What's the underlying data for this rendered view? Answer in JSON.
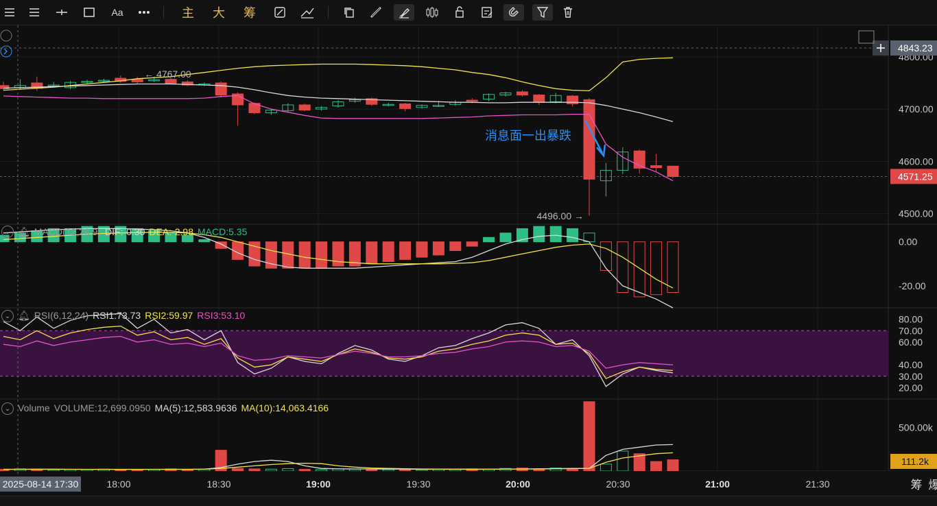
{
  "toolbar": {
    "font_label": "Aa",
    "ind_main": "主",
    "ind_big": "大",
    "ind_chip": "筹"
  },
  "annotation": "消息面一出暴跌",
  "price_high_label": "4767.00",
  "price_low_label": "4496.00",
  "crosshair_price": "4843.23",
  "last_price": "4571.25",
  "volume_last": "111.2k",
  "crosshair_time": "2025-08-14 17:30",
  "corner_label": "筹",
  "corner_label2": "爆",
  "macd": {
    "name": "MACD(12,26,9)",
    "dif": "DIF:-0.30",
    "dea": "DEA:-2.98",
    "macd": "MACD:5.35"
  },
  "rsi": {
    "name": "RSI(6,12,24)",
    "rsi1": "RSI1:73.73",
    "rsi2": "RSI2:59.97",
    "rsi3": "RSI3:53.10"
  },
  "volume": {
    "name": "Volume",
    "vol": "VOLUME:12,699.0950",
    "ma5": "MA(5):12,583.9636",
    "ma10": "MA(10):14,063.4166"
  },
  "colors": {
    "up": "#2ebd85",
    "down": "#e04848",
    "ma_yellow": "#f2e24b",
    "ma_white": "#d9d9d9",
    "ma_pink": "#e454c8",
    "accent_blue": "#2f8ff0",
    "vol_tag": "#e0a21a"
  },
  "chart_data": {
    "type": "candlestick",
    "x_ticks": [
      "18:00",
      "18:30",
      "19:00",
      "19:30",
      "20:00",
      "20:30",
      "21:00",
      "21:30"
    ],
    "price_ticks": [
      "4800.00",
      "4700.00",
      "4600.00",
      "4500.00"
    ],
    "macd_ticks": [
      "0.00",
      "-20.00"
    ],
    "rsi_ticks": [
      "80.00",
      "70.00",
      "60.00",
      "40.00",
      "30.00",
      "20.00"
    ],
    "volume_ticks": [
      "500.00k"
    ],
    "candles": [
      {
        "o": 4745,
        "c": 4739,
        "h": 4752,
        "l": 4736
      },
      {
        "o": 4741,
        "c": 4745,
        "h": 4757,
        "l": 4737
      },
      {
        "o": 4750,
        "c": 4740,
        "h": 4762,
        "l": 4735
      },
      {
        "o": 4745,
        "c": 4746,
        "h": 4752,
        "l": 4741
      },
      {
        "o": 4741,
        "c": 4751,
        "h": 4754,
        "l": 4738
      },
      {
        "o": 4752,
        "c": 4753,
        "h": 4756,
        "l": 4748
      },
      {
        "o": 4753,
        "c": 4755,
        "h": 4758,
        "l": 4750
      },
      {
        "o": 4759,
        "c": 4753,
        "h": 4764,
        "l": 4750
      },
      {
        "o": 4757,
        "c": 4752,
        "h": 4762,
        "l": 4749
      },
      {
        "o": 4756,
        "c": 4756,
        "h": 4762,
        "l": 4752
      },
      {
        "o": 4757,
        "c": 4749,
        "h": 4760,
        "l": 4747
      },
      {
        "o": 4752,
        "c": 4746,
        "h": 4755,
        "l": 4744
      },
      {
        "o": 4748,
        "c": 4748,
        "h": 4751,
        "l": 4744
      },
      {
        "o": 4750,
        "c": 4727,
        "h": 4753,
        "l": 4722
      },
      {
        "o": 4729,
        "c": 4708,
        "h": 4732,
        "l": 4668
      },
      {
        "o": 4711,
        "c": 4693,
        "h": 4713,
        "l": 4690
      },
      {
        "o": 4693,
        "c": 4698,
        "h": 4701,
        "l": 4689
      },
      {
        "o": 4697,
        "c": 4708,
        "h": 4711,
        "l": 4694
      },
      {
        "o": 4708,
        "c": 4698,
        "h": 4710,
        "l": 4696
      },
      {
        "o": 4700,
        "c": 4703,
        "h": 4706,
        "l": 4697
      },
      {
        "o": 4706,
        "c": 4714,
        "h": 4717,
        "l": 4703
      },
      {
        "o": 4715,
        "c": 4718,
        "h": 4722,
        "l": 4712
      },
      {
        "o": 4720,
        "c": 4709,
        "h": 4722,
        "l": 4706
      },
      {
        "o": 4707,
        "c": 4709,
        "h": 4712,
        "l": 4705
      },
      {
        "o": 4710,
        "c": 4701,
        "h": 4712,
        "l": 4696
      },
      {
        "o": 4703,
        "c": 4707,
        "h": 4709,
        "l": 4701
      },
      {
        "o": 4707,
        "c": 4707,
        "h": 4716,
        "l": 4704
      },
      {
        "o": 4709,
        "c": 4713,
        "h": 4717,
        "l": 4706
      },
      {
        "o": 4717,
        "c": 4715,
        "h": 4721,
        "l": 4711
      },
      {
        "o": 4719,
        "c": 4728,
        "h": 4730,
        "l": 4715
      },
      {
        "o": 4727,
        "c": 4731,
        "h": 4733,
        "l": 4724
      },
      {
        "o": 4733,
        "c": 4727,
        "h": 4736,
        "l": 4724
      },
      {
        "o": 4727,
        "c": 4714,
        "h": 4729,
        "l": 4708
      },
      {
        "o": 4714,
        "c": 4726,
        "h": 4731,
        "l": 4711
      },
      {
        "o": 4725,
        "c": 4710,
        "h": 4727,
        "l": 4705
      },
      {
        "o": 4718,
        "c": 4566,
        "h": 4721,
        "l": 4496
      },
      {
        "o": 4563,
        "c": 4583,
        "h": 4597,
        "l": 4533
      },
      {
        "o": 4583,
        "c": 4618,
        "h": 4627,
        "l": 4576
      },
      {
        "o": 4620,
        "c": 4587,
        "h": 4623,
        "l": 4577
      },
      {
        "o": 4592,
        "c": 4588,
        "h": 4614,
        "l": 4581
      },
      {
        "o": 4591,
        "c": 4571,
        "h": 4592,
        "l": 4568
      }
    ],
    "ma_yellow": [
      4736,
      4738,
      4740,
      4742,
      4745,
      4748,
      4751,
      4754,
      4758,
      4760,
      4762,
      4766,
      4770,
      4774,
      4778,
      4781,
      4783,
      4784,
      4785,
      4786,
      4786,
      4786,
      4785,
      4784,
      4783,
      4781,
      4778,
      4775,
      4770,
      4766,
      4760,
      4752,
      4745,
      4739,
      4736,
      4735,
      4760,
      4790,
      4795,
      4797,
      4798
    ],
    "ma_white": [
      4740,
      4741,
      4742,
      4743,
      4744,
      4745,
      4746,
      4747,
      4748,
      4748,
      4748,
      4747,
      4746,
      4745,
      4742,
      4737,
      4731,
      4726,
      4723,
      4721,
      4720,
      4719,
      4718,
      4717,
      4716,
      4715,
      4714,
      4713,
      4713,
      4712,
      4712,
      4713,
      4713,
      4713,
      4713,
      4712,
      4707,
      4700,
      4693,
      4685,
      4676
    ],
    "ma_pink": [
      4725,
      4724,
      4723,
      4722,
      4721,
      4721,
      4720,
      4720,
      4720,
      4720,
      4720,
      4720,
      4721,
      4724,
      4726,
      4710,
      4700,
      4694,
      4688,
      4683,
      4682,
      4682,
      4682,
      4682,
      4682,
      4682,
      4683,
      4684,
      4685,
      4687,
      4688,
      4689,
      4689,
      4689,
      4690,
      4690,
      4633,
      4608,
      4592,
      4580,
      4563
    ],
    "macd_hist": [
      3,
      4,
      5,
      6,
      6,
      7,
      7,
      7,
      6,
      5,
      4,
      3,
      1,
      -3,
      -8,
      -11,
      -12,
      -12,
      -12,
      -12,
      -11,
      -11,
      -10,
      -9,
      -8,
      -7,
      -6,
      -4,
      -2,
      2,
      4,
      6,
      7,
      7,
      6,
      4,
      -13,
      -23,
      -25,
      -24,
      -23
    ],
    "macd_dif": [
      4,
      4.5,
      5,
      5.5,
      5.8,
      6,
      6,
      6,
      5.8,
      5.5,
      5,
      4,
      2,
      -1,
      -5,
      -8,
      -10,
      -11.5,
      -12,
      -12,
      -12,
      -12,
      -11.5,
      -11,
      -10.5,
      -10,
      -9.5,
      -9,
      -7,
      -4,
      -1,
      1,
      2.5,
      3,
      2,
      0,
      -12,
      -20,
      -23,
      -26,
      -30
    ],
    "macd_dea": [
      1,
      1.5,
      2,
      2.5,
      3,
      3.5,
      3.8,
      4,
      4.2,
      4.3,
      4.3,
      4,
      3.2,
      2,
      0,
      -2,
      -4,
      -5.5,
      -7,
      -8,
      -9,
      -9.5,
      -10,
      -10,
      -10,
      -10,
      -10,
      -9.8,
      -9.5,
      -8.5,
      -7,
      -5.5,
      -4,
      -2.5,
      -1.5,
      -1,
      -3,
      -7,
      -12,
      -17,
      -21
    ],
    "rsi1": [
      78,
      70,
      82,
      72,
      79,
      83,
      84,
      85,
      72,
      80,
      68,
      71,
      62,
      70,
      42,
      32,
      37,
      47,
      43,
      41,
      50,
      57,
      53,
      45,
      43,
      48,
      55,
      57,
      63,
      68,
      75,
      77,
      72,
      58,
      62,
      48,
      21,
      32,
      38,
      35,
      33
    ],
    "rsi2": [
      65,
      62,
      70,
      63,
      68,
      71,
      73,
      74,
      66,
      69,
      62,
      64,
      58,
      63,
      46,
      38,
      40,
      47,
      45,
      43,
      49,
      54,
      51,
      46,
      45,
      47,
      52,
      54,
      58,
      61,
      66,
      68,
      66,
      58,
      59,
      50,
      28,
      34,
      38,
      36,
      35
    ],
    "rsi3": [
      58,
      56,
      61,
      57,
      60,
      62,
      64,
      65,
      60,
      62,
      58,
      59,
      56,
      59,
      48,
      44,
      45,
      48,
      47,
      46,
      49,
      52,
      50,
      47,
      47,
      48,
      50,
      51,
      54,
      56,
      60,
      61,
      60,
      56,
      57,
      52,
      37,
      40,
      42,
      41,
      40
    ],
    "volume": [
      20,
      25,
      22,
      15,
      20,
      18,
      22,
      15,
      18,
      20,
      25,
      18,
      22,
      240,
      30,
      25,
      22,
      28,
      20,
      18,
      25,
      22,
      20,
      18,
      25,
      15,
      20,
      18,
      25,
      22,
      30,
      35,
      20,
      35,
      25,
      800,
      80,
      230,
      200,
      110,
      130
    ],
    "vol_ma5": [
      20,
      20,
      21,
      21,
      20,
      19,
      19,
      19,
      19,
      19,
      20,
      20,
      21,
      40,
      80,
      110,
      125,
      110,
      60,
      30,
      25,
      24,
      24,
      22,
      22,
      20,
      20,
      20,
      20,
      20,
      22,
      24,
      26,
      28,
      30,
      30,
      180,
      250,
      275,
      300,
      305
    ],
    "vol_ma10": [
      20,
      20,
      20,
      20,
      20,
      20,
      20,
      20,
      20,
      20,
      20,
      20,
      21,
      30,
      45,
      60,
      75,
      85,
      90,
      85,
      60,
      45,
      35,
      30,
      26,
      24,
      22,
      22,
      22,
      21,
      22,
      23,
      24,
      26,
      28,
      30,
      100,
      150,
      175,
      200,
      210
    ]
  }
}
